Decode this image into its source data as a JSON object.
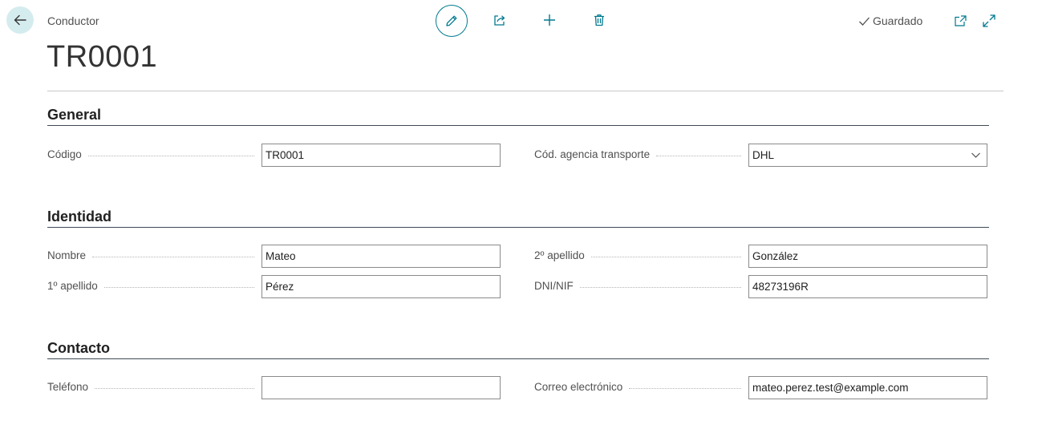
{
  "header": {
    "caption": "Conductor",
    "title": "TR0001",
    "status": "Guardado"
  },
  "icons": {
    "back": "arrow-left-icon",
    "edit": "pencil-icon",
    "share": "share-icon",
    "add": "plus-icon",
    "delete": "trash-icon",
    "saved": "check-icon",
    "open_new": "open-new-window-icon",
    "expand": "expand-icon",
    "dropdown": "chevron-down-icon"
  },
  "colors": {
    "accent": "#00798f",
    "back_bg": "#d5ecef"
  },
  "sections": {
    "general": {
      "title": "General",
      "codigo": {
        "label": "Código",
        "value": "TR0001"
      },
      "agencia": {
        "label": "Cód. agencia transporte",
        "value": "DHL"
      }
    },
    "identidad": {
      "title": "Identidad",
      "nombre": {
        "label": "Nombre",
        "value": "Mateo"
      },
      "apellido1": {
        "label": "1º apellido",
        "value": "Pérez"
      },
      "apellido2": {
        "label": "2º apellido",
        "value": "González"
      },
      "dni": {
        "label": "DNI/NIF",
        "value": "48273196R"
      }
    },
    "contacto": {
      "title": "Contacto",
      "telefono": {
        "label": "Teléfono",
        "value": ""
      },
      "correo": {
        "label": "Correo electrónico",
        "value": "mateo.perez.test@example.com"
      }
    }
  }
}
